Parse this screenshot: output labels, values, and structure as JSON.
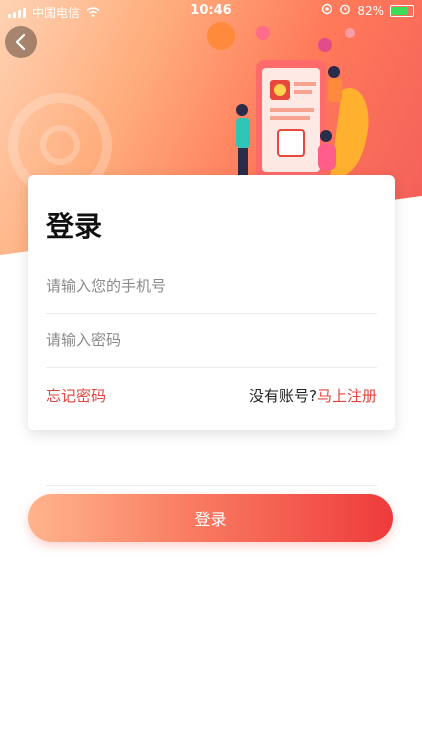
{
  "status_bar": {
    "carrier": "中国电信",
    "time": "10:46",
    "battery": "82%"
  },
  "login_card": {
    "title": "登录",
    "phone_placeholder": "请输入您的手机号",
    "password_placeholder": "请输入密码",
    "forgot_password": "忘记密码",
    "no_account": "没有账号?",
    "register_link": "马上注册"
  },
  "login_button": {
    "label": "登录"
  },
  "colors": {
    "accent": "#e0443e",
    "gradient_start": "#ffb48c",
    "gradient_end": "#ee3b3b"
  }
}
